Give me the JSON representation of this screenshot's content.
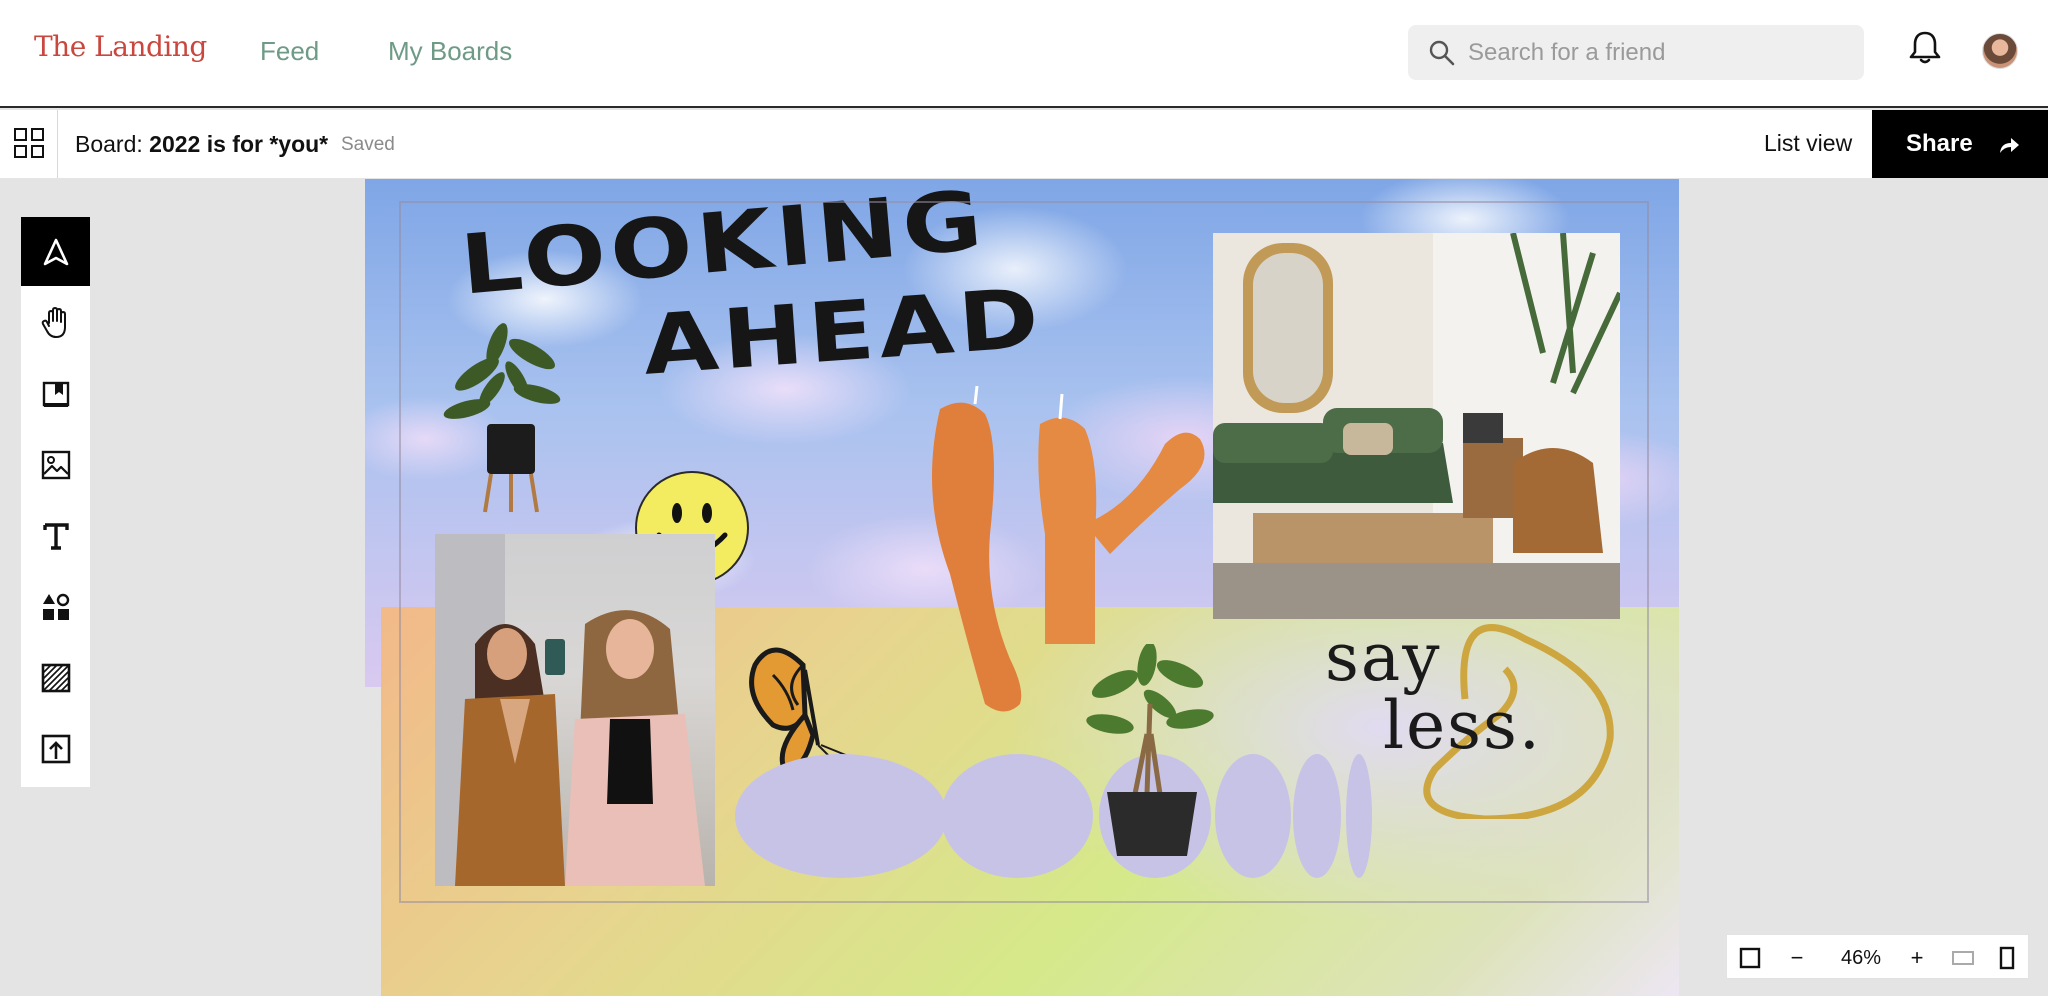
{
  "nav": {
    "logo": "The Landing",
    "links": [
      "Feed",
      "My Boards"
    ],
    "search_placeholder": "Search for a friend"
  },
  "board": {
    "prefix": "Board:",
    "name": "2022 is for *you*",
    "status": "Saved",
    "list_view": "List view",
    "share": "Share"
  },
  "toolbar": {
    "tools": [
      "select-arrow",
      "hand-pan",
      "sticky-note",
      "image",
      "text",
      "shapes",
      "pattern",
      "upload"
    ],
    "active": "select-arrow"
  },
  "collage": {
    "headline_line1": "LOOKING",
    "headline_line2": "AHEAD",
    "caption_line1": "say",
    "caption_line2": "less."
  },
  "zoom": {
    "minus": "−",
    "value": "46%",
    "plus": "+"
  },
  "colors": {
    "brand": "#c9473e",
    "nav_link": "#6e9a86",
    "share_bg": "#000000"
  }
}
